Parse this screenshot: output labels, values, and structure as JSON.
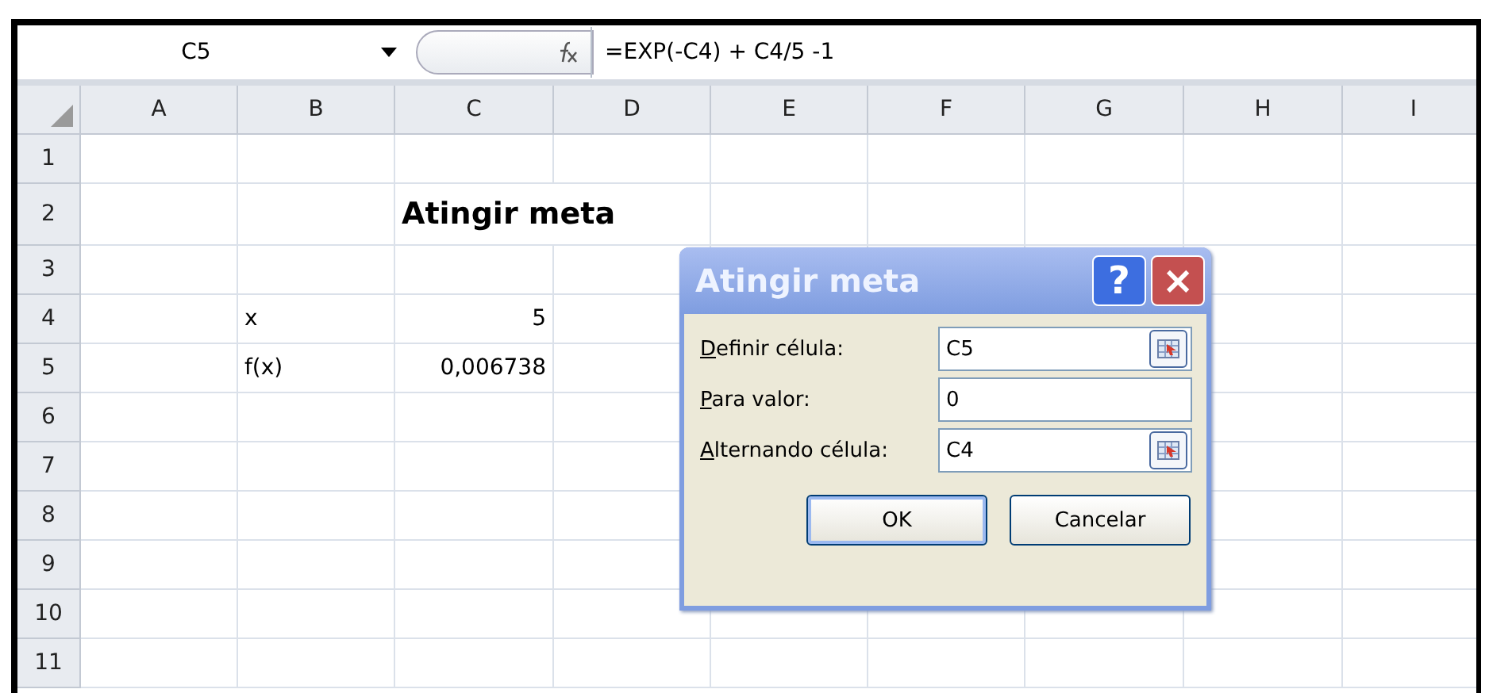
{
  "name_box": "C5",
  "formula": "=EXP(-C4) + C4/5 -1",
  "columns": [
    "A",
    "B",
    "C",
    "D",
    "E",
    "F",
    "G",
    "H",
    "I"
  ],
  "rows": [
    {
      "number": "1",
      "cells": {}
    },
    {
      "number": "2",
      "cells": {
        "C": {
          "text": "Atingir meta",
          "kind": "title"
        }
      }
    },
    {
      "number": "3",
      "cells": {}
    },
    {
      "number": "4",
      "cells": {
        "B": {
          "text": "x",
          "kind": "text"
        },
        "C": {
          "text": "5",
          "kind": "number"
        }
      }
    },
    {
      "number": "5",
      "cells": {
        "B": {
          "text": "f(x)",
          "kind": "text"
        },
        "C": {
          "text": "0,006738",
          "kind": "number"
        }
      }
    },
    {
      "number": "6",
      "cells": {}
    },
    {
      "number": "7",
      "cells": {}
    },
    {
      "number": "8",
      "cells": {}
    },
    {
      "number": "9",
      "cells": {}
    },
    {
      "number": "10",
      "cells": {}
    },
    {
      "number": "11",
      "cells": {}
    }
  ],
  "dialog": {
    "title": "Atingir meta",
    "help": "?",
    "close": "×",
    "fields": [
      {
        "label": "Definir célula:",
        "value": "C5",
        "picker": true,
        "underline_first": true
      },
      {
        "label": "Para valor:",
        "value": "0",
        "picker": false,
        "underline_first": true
      },
      {
        "label": "Alternando célula:",
        "value": "C4",
        "picker": true,
        "underline_first": true
      }
    ],
    "buttons": [
      {
        "label": "OK",
        "default": true
      },
      {
        "label": "Cancelar",
        "default": false
      }
    ]
  }
}
